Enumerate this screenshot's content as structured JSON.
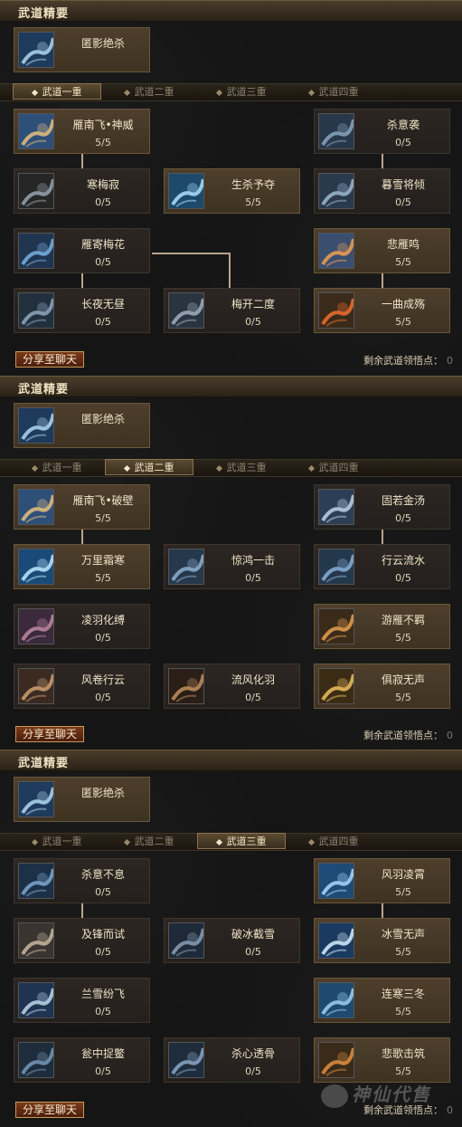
{
  "sections": [
    {
      "title": "武道精要",
      "summary": "匿影绝杀",
      "tabs": [
        "武道一重",
        "武道二重",
        "武道三重",
        "武道四重"
      ],
      "active_tab": 0,
      "skills": [
        {
          "name": "雁南飞•神威",
          "level": "5/5",
          "icon": "wind-slash-icon",
          "lit": true
        },
        {
          "name": "杀意袭",
          "level": "0/5",
          "icon": "phantom-icon",
          "lit": false
        },
        {
          "name": "寒梅寂",
          "level": "0/5",
          "icon": "blade-icon",
          "lit": false
        },
        {
          "name": "生杀予夺",
          "level": "5/5",
          "icon": "ice-shard-icon",
          "lit": true
        },
        {
          "name": "暮雪将倾",
          "level": "0/5",
          "icon": "snow-beast-icon",
          "lit": false
        },
        {
          "name": "雁寄梅花",
          "level": "0/5",
          "icon": "spirit-icon",
          "lit": false
        },
        {
          "name": "悲雁鸣",
          "level": "5/5",
          "icon": "flame-wing-icon",
          "lit": true
        },
        {
          "name": "长夜无昼",
          "level": "0/5",
          "icon": "night-beast-icon",
          "lit": false
        },
        {
          "name": "梅开二度",
          "level": "0/5",
          "icon": "beast-claw-icon",
          "lit": false
        },
        {
          "name": "一曲成殇",
          "level": "5/5",
          "icon": "fire-burst-icon",
          "lit": true
        }
      ],
      "share": "分享至聊天",
      "remain_label": "剩余武道领悟点：",
      "remain_value": "0"
    },
    {
      "title": "武道精要",
      "summary": "匿影绝杀",
      "tabs": [
        "武道一重",
        "武道二重",
        "武道三重",
        "武道四重"
      ],
      "active_tab": 1,
      "skills": [
        {
          "name": "雁南飞•破壁",
          "level": "5/5",
          "icon": "wind-slash-icon",
          "lit": true
        },
        {
          "name": "固若金汤",
          "level": "0/5",
          "icon": "ghost-shield-icon",
          "lit": false
        },
        {
          "name": "万里霜寒",
          "level": "5/5",
          "icon": "frost-icon",
          "lit": true
        },
        {
          "name": "惊鸿一击",
          "level": "0/5",
          "icon": "strike-icon",
          "lit": false
        },
        {
          "name": "行云流水",
          "level": "0/5",
          "icon": "flow-icon",
          "lit": false
        },
        {
          "name": "凌羽化缚",
          "level": "0/5",
          "icon": "feather-bind-icon",
          "lit": false
        },
        {
          "name": "游雁不羁",
          "level": "5/5",
          "icon": "wild-goose-icon",
          "lit": true
        },
        {
          "name": "风卷行云",
          "level": "0/5",
          "icon": "wind-cloud-icon",
          "lit": false
        },
        {
          "name": "流风化羽",
          "level": "0/5",
          "icon": "feather-wind-icon",
          "lit": false
        },
        {
          "name": "俱寂无声",
          "level": "5/5",
          "icon": "silence-icon",
          "lit": true
        }
      ],
      "share": "分享至聊天",
      "remain_label": "剩余武道领悟点：",
      "remain_value": "0"
    },
    {
      "title": "武道精要",
      "summary": "匿影绝杀",
      "tabs": [
        "武道一重",
        "武道二重",
        "武道三重",
        "武道四重"
      ],
      "active_tab": 2,
      "skills": [
        {
          "name": "杀意不息",
          "level": "0/5",
          "icon": "wolf-icon",
          "lit": false
        },
        {
          "name": "风羽凌霄",
          "level": "5/5",
          "icon": "sky-feather-icon",
          "lit": true
        },
        {
          "name": "及锋而试",
          "level": "0/5",
          "icon": "warrior-face-icon",
          "lit": false
        },
        {
          "name": "破冰截雪",
          "level": "0/5",
          "icon": "ice-break-icon",
          "lit": false
        },
        {
          "name": "冰雪无声",
          "level": "5/5",
          "icon": "ice-lance-icon",
          "lit": true
        },
        {
          "name": "兰雪纷飞",
          "level": "0/5",
          "icon": "shark-icon",
          "lit": false
        },
        {
          "name": "连寒三冬",
          "level": "5/5",
          "icon": "frost-giant-icon",
          "lit": true
        },
        {
          "name": "瓮中捉鳖",
          "level": "0/5",
          "icon": "trap-icon",
          "lit": false
        },
        {
          "name": "杀心透骨",
          "level": "0/5",
          "icon": "bone-beast-icon",
          "lit": false
        },
        {
          "name": "悲歌击筑",
          "level": "5/5",
          "icon": "dirge-icon",
          "lit": true
        }
      ],
      "share": "分享至聊天",
      "remain_label": "剩余武道领悟点：",
      "remain_value": "0"
    }
  ],
  "watermark": "神仙代售"
}
